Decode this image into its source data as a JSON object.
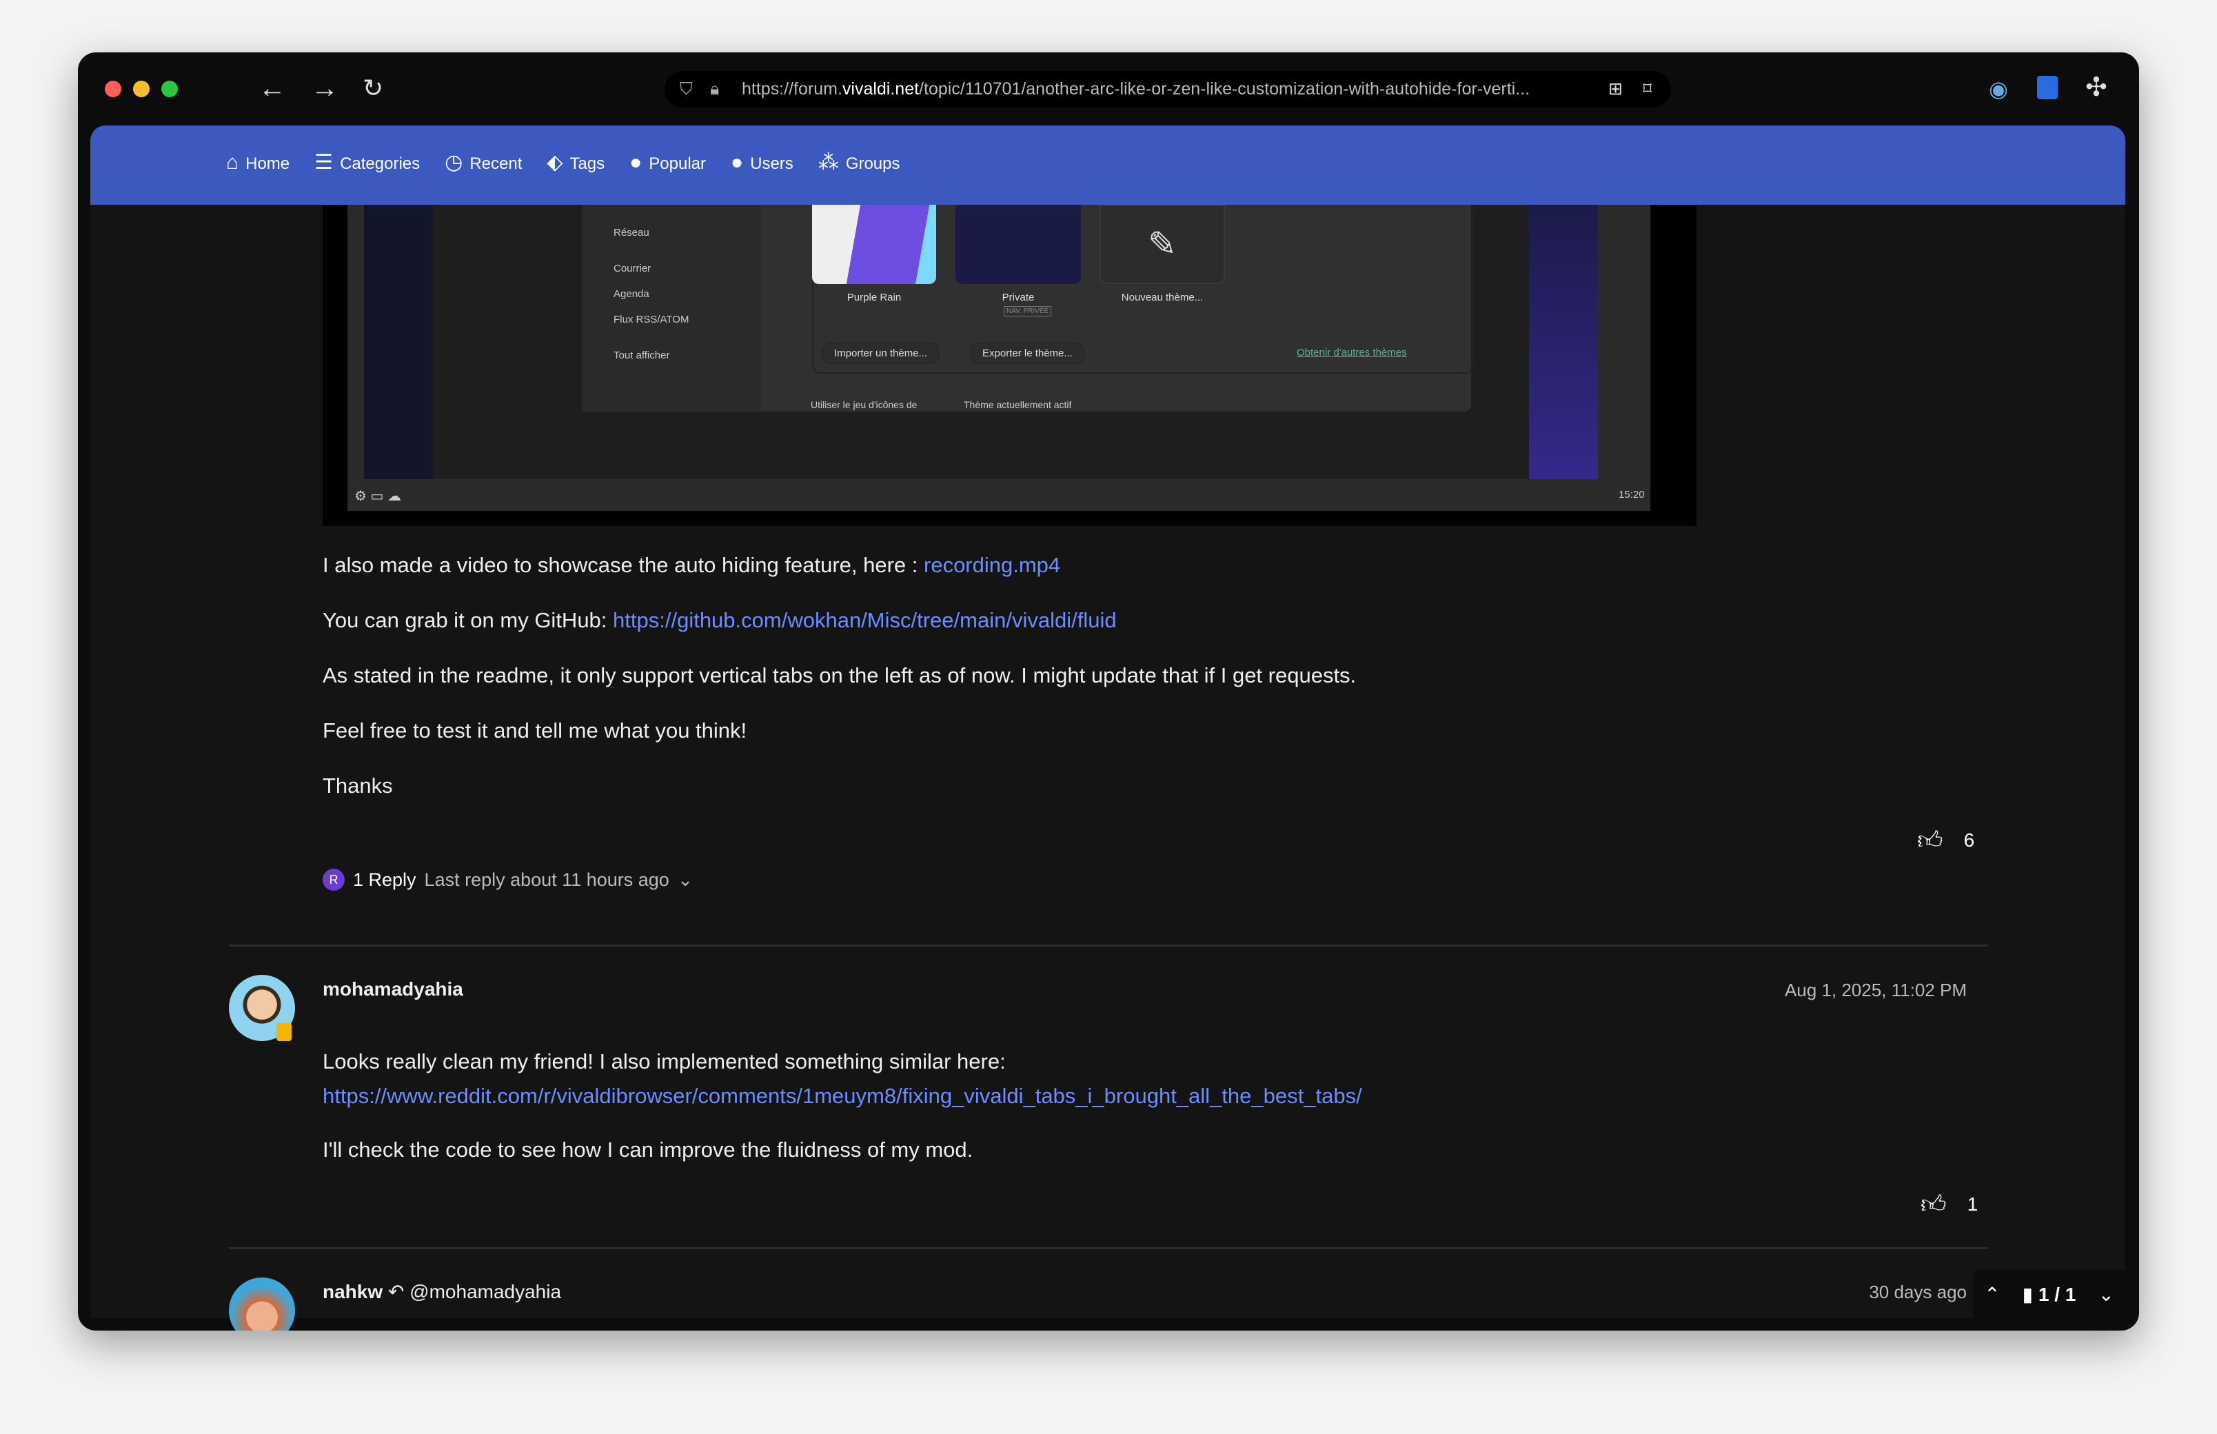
{
  "browser": {
    "url_prefix": "https://forum.",
    "url_domain": "vivaldi.net",
    "url_rest": "/topic/110701/another-arc-like-or-zen-like-customization-with-autohide-for-verti..."
  },
  "nav": [
    {
      "icon": "home-icon",
      "label": "Home"
    },
    {
      "icon": "list-icon",
      "label": "Categories"
    },
    {
      "icon": "clock-icon",
      "label": "Recent"
    },
    {
      "icon": "tag-icon",
      "label": "Tags"
    },
    {
      "icon": "fire-icon",
      "label": "Popular"
    },
    {
      "icon": "user-icon",
      "label": "Users"
    },
    {
      "icon": "users-icon",
      "label": "Groups"
    }
  ],
  "embedded": {
    "sidebar": [
      "Réseau",
      "Courrier",
      "Agenda",
      "Flux RSS/ATOM",
      "Tout afficher"
    ],
    "themes": [
      "Purple Rain",
      "Private",
      "Nouveau thème..."
    ],
    "private_badge": "NAV. PRIVÉE",
    "import": "Importer un thème...",
    "export": "Exporter le thème...",
    "more": "Obtenir d'autres thèmes",
    "checkbox": "Utiliser le jeu d'icônes de",
    "select": "Thème actuellement actif",
    "clock": "15:20"
  },
  "post1": {
    "video_text": "I also made a video to showcase the auto hiding feature, here : ",
    "video_link": "recording.mp4",
    "github_text": "You can grab it on my GitHub: ",
    "github_link": "https://github.com/wokhan/Misc/tree/main/vivaldi/fluid",
    "line3": "As stated in the readme, it only support vertical tabs on the left as of now. I might update that if I get requests.",
    "line4": "Feel free to test it and tell me what you think!",
    "line5": "Thanks",
    "likes": "6",
    "reply_avatar": "R",
    "replies": "1 Reply",
    "last_reply": "Last reply about 11 hours ago"
  },
  "post2": {
    "author": "mohamadyahia",
    "date": "Aug 1, 2025, 11:02 PM",
    "line1": "Looks really clean my friend! I also implemented something similar here:",
    "link": "https://www.reddit.com/r/vivaldibrowser/comments/1meuym8/fixing_vivaldi_tabs_i_brought_all_the_best_tabs/",
    "line2": "I'll check the code to see how I can improve the fluidness of my mod.",
    "likes": "1"
  },
  "post3": {
    "author": "nahkw",
    "reply_to": "@mohamadyahia",
    "date": "30 days ago"
  },
  "pagination": {
    "label": "1 / 1"
  }
}
